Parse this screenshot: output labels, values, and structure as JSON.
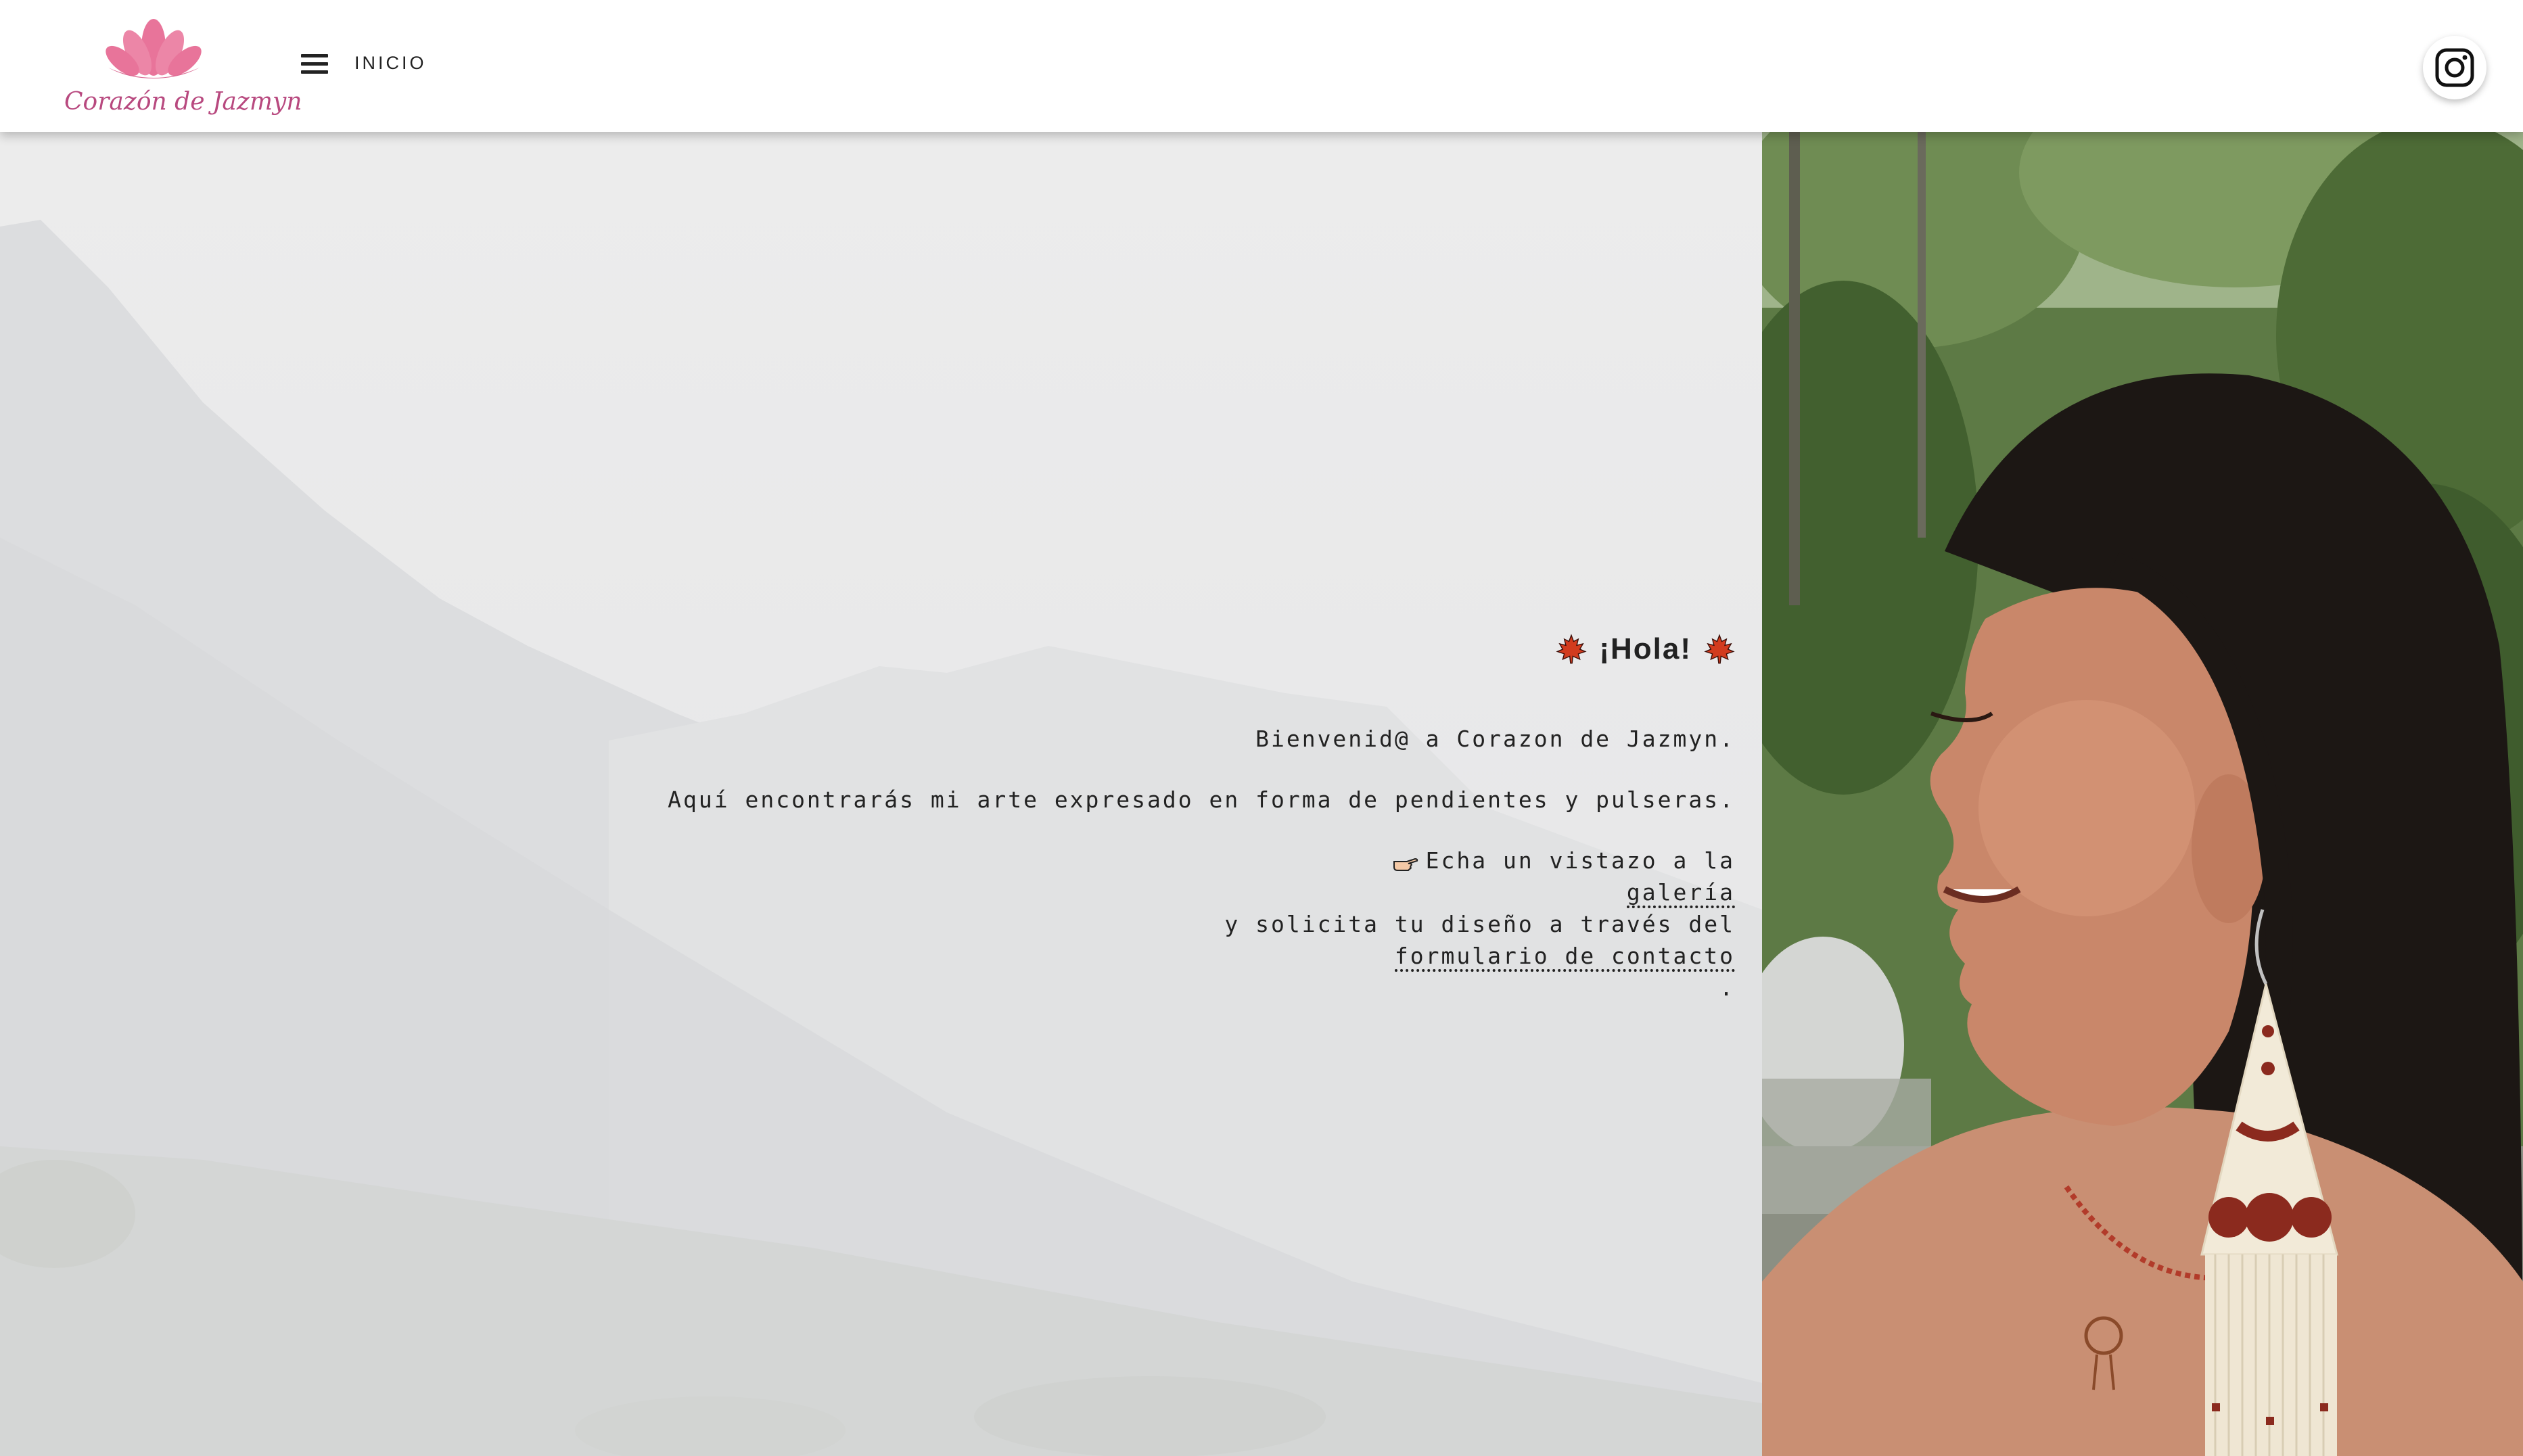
{
  "header": {
    "logo_text": "Corazón de Jazmyn",
    "nav_label": "INICIO",
    "brand_color": "#e8749a",
    "icons": {
      "menu": "hamburger-menu-icon",
      "social": "instagram-icon"
    }
  },
  "hero": {
    "greeting": "¡Hola!",
    "welcome_line": "Bienvenid@ a Corazon de Jazmyn.",
    "description_line": "Aquí encontrarás mi arte expresado en forma de pendientes y pulseras.",
    "cta_prefix": "Echa un vistazo a la",
    "gallery_link": "galería",
    "cta_middle": "y solicita tu diseño a través del",
    "contact_link": "formulario de contacto",
    "cta_end": ".",
    "icons": {
      "greeting_decoration": "maple-leaf-icon",
      "pointer": "pointing-hand-icon"
    }
  },
  "photo": {
    "subject": "woman-with-beaded-earring",
    "earring_colors": [
      "#f2ead8",
      "#8b2a1e"
    ]
  }
}
